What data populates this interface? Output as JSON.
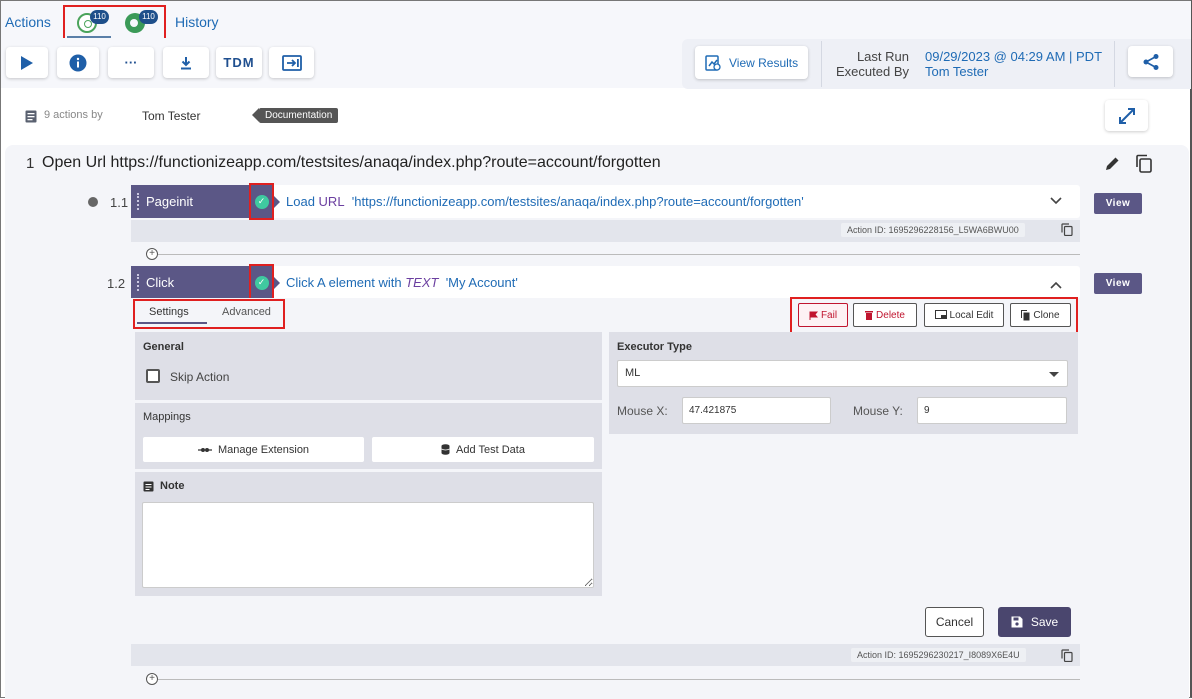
{
  "tabs": {
    "actions": "Actions",
    "history": "History",
    "browsers": [
      {
        "icon": "chrome-icon",
        "badge": "110"
      },
      {
        "icon": "edge-icon",
        "badge": "110"
      }
    ]
  },
  "toolbar": {
    "tdm_label": "TDM",
    "more_label": "···"
  },
  "run": {
    "view_results": "View Results",
    "last_run_label": "Last Run",
    "last_run_value": "09/29/2023 @ 04:29 AM | PDT",
    "executed_by_label": "Executed By",
    "executed_by_value": "Tom Tester"
  },
  "summary": {
    "count": "9 actions by",
    "user": "Tom Tester",
    "tag": "Documentation"
  },
  "step": {
    "number": "1",
    "title": "Open Url https://functionizeapp.com/testsites/anaqa/index.php?route=account/forgotten"
  },
  "actions": [
    {
      "number": "1.1",
      "type": "Pageinit",
      "desc_pre": "Load ",
      "desc_kw": "URL",
      "desc_val": "'https://functionizeapp.com/testsites/anaqa/index.php?route=account/forgotten'",
      "view": "View",
      "action_id": "Action ID: 1695296228156_L5WA6BWU00"
    },
    {
      "number": "1.2",
      "type": "Click",
      "desc_pre": "Click A  element with ",
      "desc_kw": "TEXT",
      "desc_val": "'My Account'",
      "view": "View",
      "action_id": "Action ID: 1695296230217_I8089X6E4U"
    }
  ],
  "editor": {
    "tabs": [
      "Settings",
      "Advanced"
    ],
    "buttons": {
      "fail": "Fail",
      "delete": "Delete",
      "local_edit": "Local Edit",
      "clone": "Clone"
    },
    "general_title": "General",
    "skip_action": "Skip Action",
    "mappings_title": "Mappings",
    "manage_extension": "Manage Extension",
    "add_test_data": "Add Test Data",
    "note_title": "Note",
    "executor_title": "Executor Type",
    "executor_value": "ML",
    "mouse_x_label": "Mouse X:",
    "mouse_x_value": "47.421875",
    "mouse_y_label": "Mouse Y:",
    "mouse_y_value": "9",
    "cancel": "Cancel",
    "save": "Save"
  },
  "colors": {
    "accent": "#1f6bb5",
    "action_type_bg": "#5b5786",
    "check": "#3fc9a0",
    "highlight": "#e02020",
    "fail": "#c0152f"
  }
}
